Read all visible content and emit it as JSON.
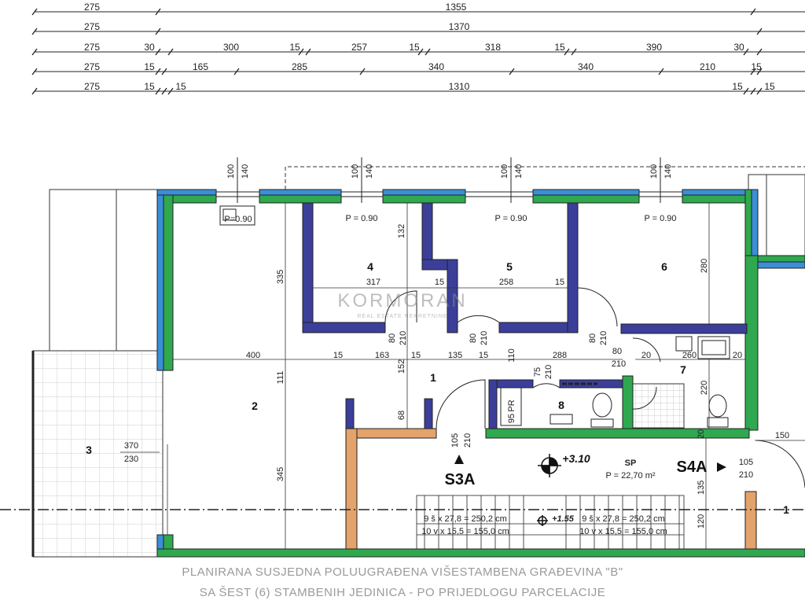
{
  "dim_rows": [
    [
      "275",
      "1355"
    ],
    [
      "275",
      "1370"
    ],
    [
      "275",
      "30",
      "300",
      "15",
      "257",
      "15",
      "318",
      "15",
      "390",
      "30"
    ],
    [
      "275",
      "15",
      "165",
      "285",
      "340",
      "340",
      "210",
      "15"
    ],
    [
      "275",
      "15",
      "15",
      "1310",
      "15",
      "15"
    ]
  ],
  "window_dims": [
    "100",
    "140",
    "100",
    "140",
    "100",
    "140",
    "100",
    "140"
  ],
  "rooms": {
    "r1": "1",
    "r2": "2",
    "r3": "3",
    "r4": "4",
    "r5": "5",
    "r6": "6",
    "r7": "7",
    "r8": "8",
    "r1_right": "1"
  },
  "parapet": {
    "p4": "P = 0.90",
    "p5": "P = 0.90",
    "p6": "P = 0.90",
    "sink": "P=0.90"
  },
  "interior_dims": {
    "d317": "317",
    "d15a": "15",
    "d258": "258",
    "d15b": "15",
    "d400": "400",
    "d15c": "15",
    "d163": "163",
    "d15d": "15",
    "d135": "135",
    "d15e": "15",
    "d288": "288",
    "d260": "260",
    "d20a": "20",
    "d20b": "20",
    "v335": "335",
    "v111": "111",
    "v345": "345",
    "v132": "132",
    "v152": "152",
    "v68": "68",
    "v280": "280",
    "v220": "220",
    "v135": "135",
    "v120": "120",
    "v110": "110",
    "v20": "20",
    "d150": "150"
  },
  "doors": {
    "door_4": [
      "80",
      "210"
    ],
    "door_5": [
      "80",
      "210"
    ],
    "door_6": [
      "80",
      "210"
    ],
    "door_7": [
      "80",
      "210"
    ],
    "door_8": [
      "75",
      "210"
    ],
    "door_1": [
      "105",
      "210"
    ],
    "door_s4a": [
      "105",
      "210"
    ],
    "door_wc": [
      "95",
      "PR"
    ],
    "room3": [
      "370",
      "230"
    ]
  },
  "stairs": {
    "s3a": "S3A",
    "s4a": "S4A",
    "left_1": "9 š x 27,8 = 250,2 cm",
    "left_2": "10 v x 15,5 = 155,0 cm",
    "right_1": "9 š x 27,8 = 250,2 cm",
    "right_2": "10 v x 15,5 = 155,0 cm",
    "level_mid": "+1.55"
  },
  "landing": {
    "level": "+3.10",
    "code": "SP",
    "area": "P = 22,70 m²"
  },
  "watermark": {
    "brand": "KORMORAN",
    "tagline": "REAL ESTATE NEKRETNINE"
  },
  "footer": {
    "line1": "PLANIRANA SUSJEDNA POLUUGRAĐENA VIŠESTAMBENA GRAĐEVINA \"B\"",
    "line2": "SA ŠEST (6) STAMBENIH JEDINICA - PO PRIJEDLOGU PARCELACIJE"
  },
  "colors": {
    "wall_green": "#2fa84f",
    "wall_blue": "#3a8fd6",
    "wall_navy": "#3b3f9a",
    "wall_orange": "#e3a36b"
  }
}
